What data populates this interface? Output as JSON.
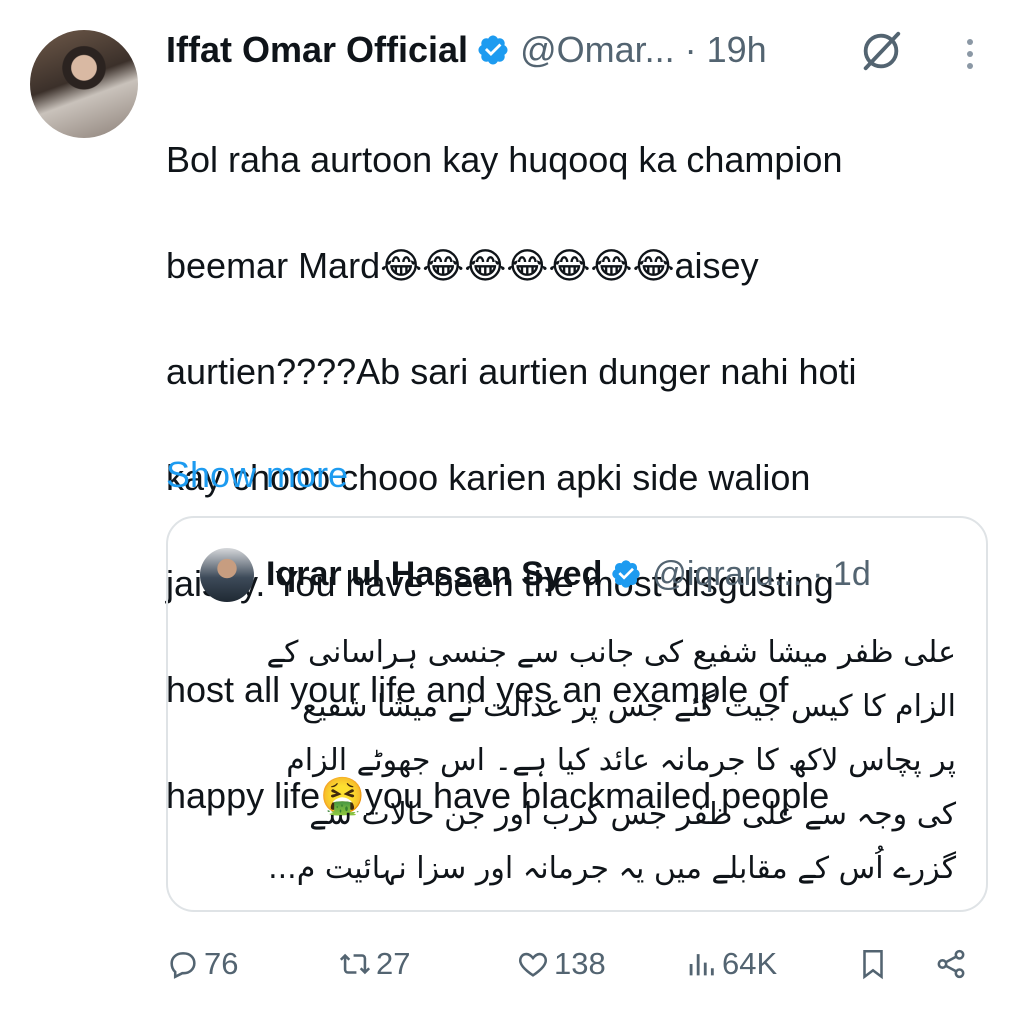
{
  "tweet": {
    "author_name": "Iffat Omar Official",
    "handle": "@Omar...",
    "time": "· 19h",
    "text_lines": [
      "Bol raha aurtoon kay huqooq ka champion",
      "beemar Mard😂😂😂😂😂😂😂aisey",
      "aurtien????Ab sari aurtien dunger nahi hoti",
      "kay chooo chooo karien apki side walion",
      "jaisey. You have been the most disgusting",
      "host all your life and yes an example of",
      "happy life🤮you have blackmailed people"
    ],
    "show_more": "Show more"
  },
  "quote": {
    "author_name": "Iqrar ul Hassan Syed",
    "handle": "@iqraru...",
    "time": "· 1d",
    "text_lines": [
      "علی ظفر میشا شفیع کی جانب سے جنسی ہراسانی کے",
      "الزام کا کیس جیت گئے جس پر عدالت نے میشا شفیع",
      "پر پچاس لاکھ کا جرمانہ عائد کیا ہے۔ اس جھوٹے الزام",
      "کی وجہ سے علی ظفر جس کرب اور جن حالات سے",
      "گزرے اُس کے مقابلے میں یہ جرمانہ اور سزا نہائیت م..."
    ]
  },
  "actions": {
    "replies": "76",
    "reposts": "27",
    "likes": "138",
    "views": "64K"
  },
  "colors": {
    "accent": "#1d9bf0",
    "muted": "#536471",
    "border": "#dfe3e6"
  },
  "icons": [
    "verified-badge-icon",
    "grok-icon",
    "more-options-icon",
    "reply-icon",
    "repost-icon",
    "like-icon",
    "views-icon",
    "bookmark-icon",
    "share-icon"
  ]
}
